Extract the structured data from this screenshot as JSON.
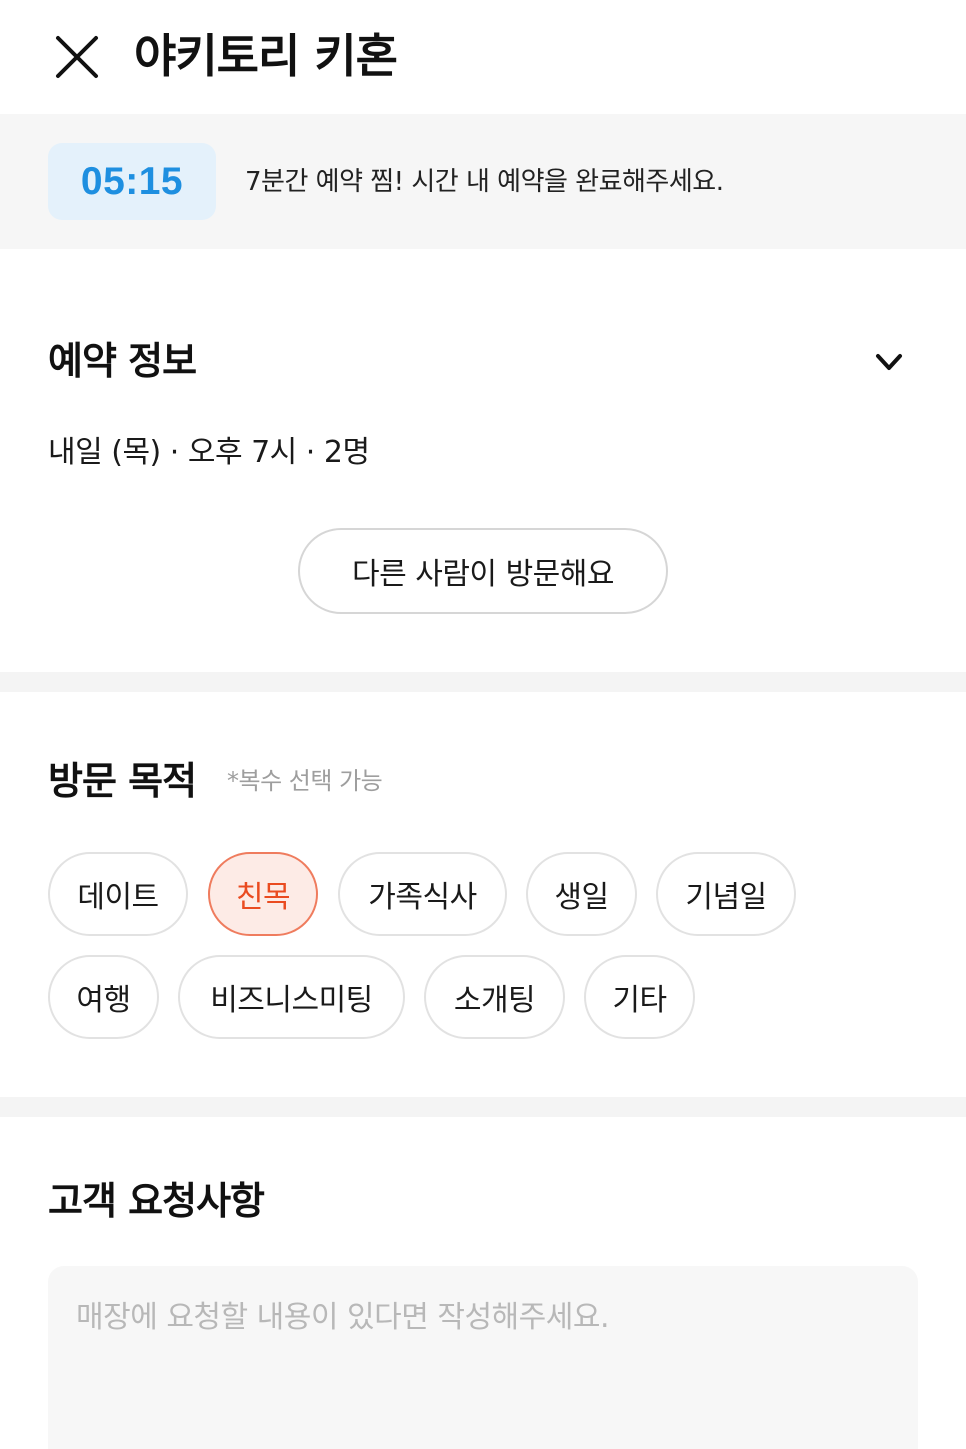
{
  "header": {
    "close_icon": "close-icon",
    "title": "야키토리 키혼"
  },
  "timer": {
    "value": "05:15",
    "message": "7분간 예약 찜! 시간 내 예약을 완료해주세요.",
    "accent_color": "#1e8fe0"
  },
  "reservation_info": {
    "title": "예약 정보",
    "expand_icon": "chevron-down-icon",
    "summary": "내일 (목) · 오후 7시 · 2명",
    "other_visitor_label": "다른 사람이 방문해요"
  },
  "visit_purpose": {
    "title": "방문 목적",
    "note": "*복수 선택 가능",
    "options": [
      {
        "label": "데이트",
        "selected": false
      },
      {
        "label": "친목",
        "selected": true
      },
      {
        "label": "가족식사",
        "selected": false
      },
      {
        "label": "생일",
        "selected": false
      },
      {
        "label": "기념일",
        "selected": false
      },
      {
        "label": "여행",
        "selected": false
      },
      {
        "label": "비즈니스미팅",
        "selected": false
      },
      {
        "label": "소개팅",
        "selected": false
      },
      {
        "label": "기타",
        "selected": false
      }
    ],
    "selected_color": "#ea4b20"
  },
  "customer_request": {
    "title": "고객 요청사항",
    "placeholder": "매장에 요청할 내용이 있다면 작성해주세요.",
    "value": ""
  }
}
